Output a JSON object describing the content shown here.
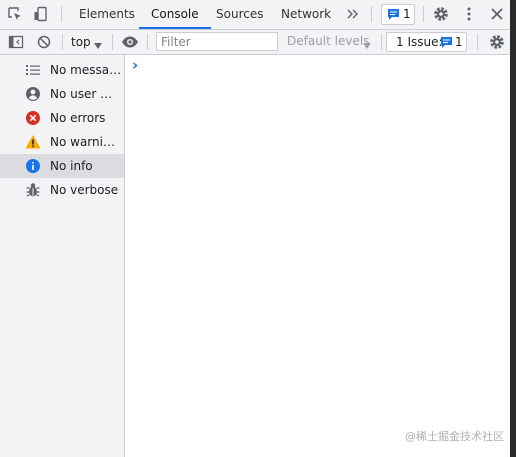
{
  "tabs": [
    {
      "label": "Elements"
    },
    {
      "label": "Console"
    },
    {
      "label": "Sources"
    },
    {
      "label": "Network"
    }
  ],
  "more_tabs_icon": "double-chevron-right-icon",
  "issues_badge_count": "1",
  "console_toolbar": {
    "context": "top",
    "filter_placeholder": "Filter",
    "levels": "Default levels",
    "issues_label": "1 Issue:",
    "issues_count": "1"
  },
  "sidebar": {
    "items": [
      {
        "label": "No messages",
        "icon": "list-icon"
      },
      {
        "label": "No user me…",
        "icon": "user-icon"
      },
      {
        "label": "No errors",
        "icon": "error-icon"
      },
      {
        "label": "No warnings",
        "icon": "warning-icon"
      },
      {
        "label": "No info",
        "icon": "info-icon"
      },
      {
        "label": "No verbose",
        "icon": "bug-icon"
      }
    ]
  },
  "prompt_symbol": "›",
  "watermark": "@稀土掘金技术社区",
  "colors": {
    "accent": "#1a73e8",
    "error": "#d93025",
    "warning": "#f9ab00",
    "info": "#1a73e8",
    "toolbar_bg": "#f1f3f4",
    "selected_bg": "#dadce0"
  }
}
